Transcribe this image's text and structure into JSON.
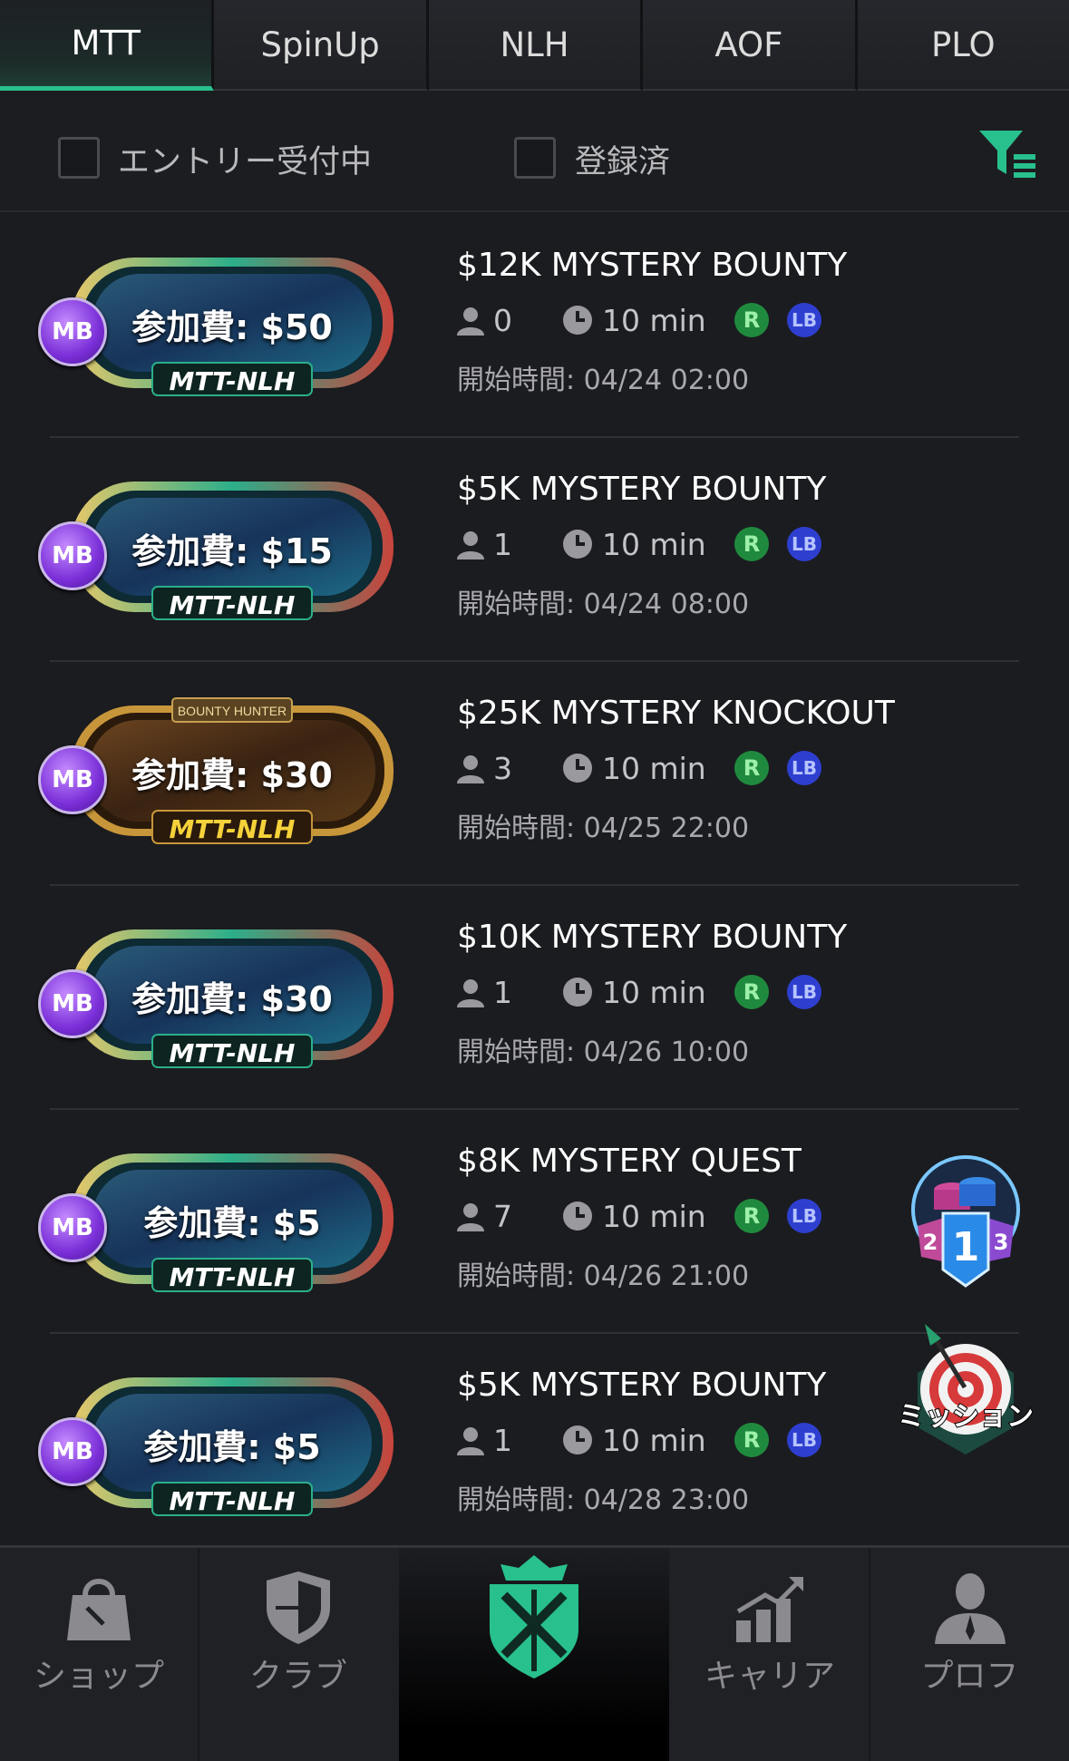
{
  "tabs": [
    {
      "label": "MTT",
      "active": true
    },
    {
      "label": "SpinUp",
      "active": false
    },
    {
      "label": "NLH",
      "active": false
    },
    {
      "label": "AOF",
      "active": false
    },
    {
      "label": "PLO",
      "active": false
    }
  ],
  "filters": {
    "entry_open_label": "エントリー受付中",
    "registered_label": "登録済",
    "filter_icon": "filter-list-icon",
    "accent_color": "#28c08d"
  },
  "tournaments": [
    {
      "fee": "参加費: $50",
      "type": "MTT-NLH",
      "badge": "MB",
      "style": "blue",
      "title": "$12K MYSTERY BOUNTY",
      "players": "0",
      "duration": "10 min",
      "r": "R",
      "lb": "LB",
      "start": "開始時間: 04/24 02:00"
    },
    {
      "fee": "参加費: $15",
      "type": "MTT-NLH",
      "badge": "MB",
      "style": "blue",
      "title": "$5K MYSTERY BOUNTY",
      "players": "1",
      "duration": "10 min",
      "r": "R",
      "lb": "LB",
      "start": "開始時間: 04/24 08:00"
    },
    {
      "fee": "参加費: $30",
      "type": "MTT-NLH",
      "badge": "MB",
      "style": "bounty",
      "banner": "BOUNTY HUNTER",
      "title": "$25K MYSTERY KNOCKOUT",
      "players": "3",
      "duration": "10 min",
      "r": "R",
      "lb": "LB",
      "start": "開始時間: 04/25 22:00"
    },
    {
      "fee": "参加費: $30",
      "type": "MTT-NLH",
      "badge": "MB",
      "style": "blue",
      "title": "$10K MYSTERY BOUNTY",
      "players": "1",
      "duration": "10 min",
      "r": "R",
      "lb": "LB",
      "start": "開始時間: 04/26 10:00"
    },
    {
      "fee": "参加費: $5",
      "type": "MTT-NLH",
      "badge": "MB",
      "style": "blue",
      "title": "$8K MYSTERY QUEST",
      "players": "7",
      "duration": "10 min",
      "r": "R",
      "lb": "LB",
      "start": "開始時間: 04/26 21:00"
    },
    {
      "fee": "参加費: $5",
      "type": "MTT-NLH",
      "badge": "MB",
      "style": "blue",
      "title": "$5K MYSTERY BOUNTY",
      "players": "1",
      "duration": "10 min",
      "r": "R",
      "lb": "LB",
      "start": "開始時間: 04/28 23:00"
    }
  ],
  "floating": {
    "ranking_numbers": [
      "2",
      "1",
      "3"
    ],
    "mission_label": "ミッション"
  },
  "nav": [
    {
      "label": "ショップ",
      "icon": "shopping-bag-icon"
    },
    {
      "label": "クラブ",
      "icon": "shield-icon"
    },
    {
      "label": "",
      "icon": "crown-shield-logo-icon",
      "active": true
    },
    {
      "label": "キャリア",
      "icon": "career-chart-icon"
    },
    {
      "label": "プロフ",
      "icon": "profile-person-icon"
    }
  ]
}
